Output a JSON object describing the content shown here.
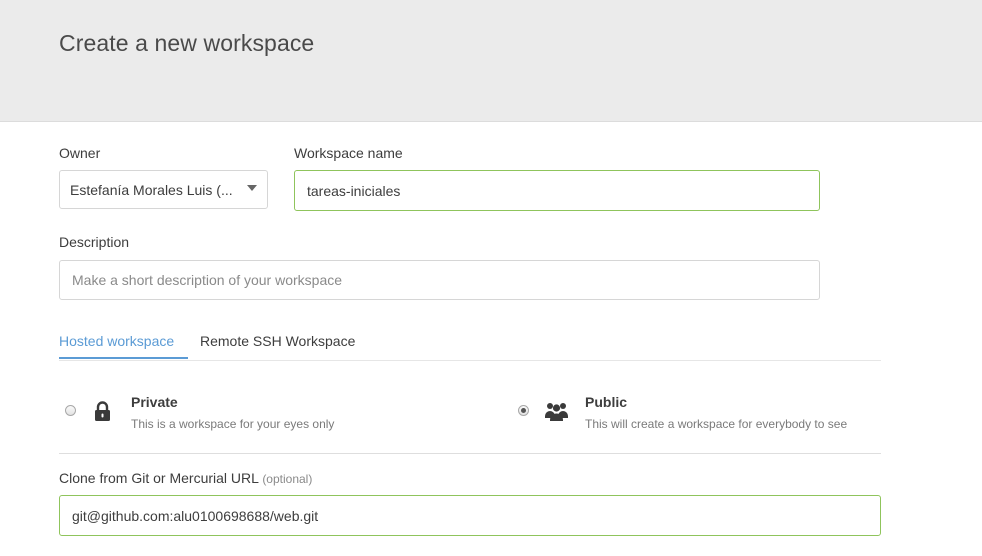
{
  "header": {
    "title": "Create a new workspace"
  },
  "owner": {
    "label": "Owner",
    "value": "Estefanía Morales Luis (..."
  },
  "workspace_name": {
    "label": "Workspace name",
    "value": "tareas-iniciales"
  },
  "description": {
    "label": "Description",
    "value": "",
    "placeholder": "Make a short description of your workspace"
  },
  "tabs": [
    {
      "label": "Hosted workspace",
      "selected": true
    },
    {
      "label": "Remote SSH Workspace",
      "selected": false
    }
  ],
  "visibility": {
    "options": [
      {
        "title": "Private",
        "description": "This is a workspace for your eyes only",
        "icon": "lock-icon",
        "selected": false
      },
      {
        "title": "Public",
        "description": "This will create a workspace for everybody to see",
        "icon": "users-icon",
        "selected": true
      }
    ]
  },
  "clone": {
    "label": "Clone from Git or Mercurial URL",
    "optional_note": "(optional)",
    "value": "git@github.com:alu0100698688/web.git"
  },
  "colors": {
    "accent_tab": "#5b9bd5",
    "focus_border": "#8fc45c",
    "header_bg": "#ebebeb"
  }
}
